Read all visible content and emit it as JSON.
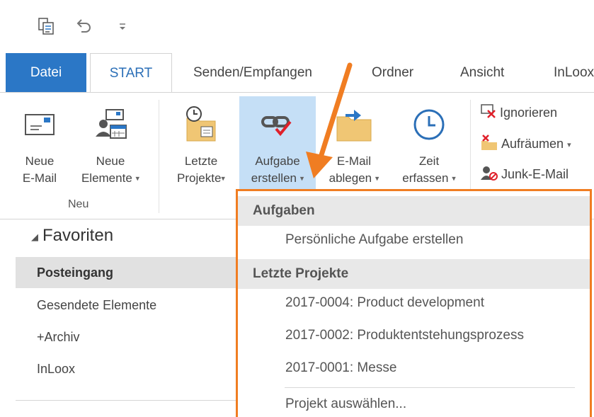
{
  "qat": {
    "icons": [
      "send-receive-icon",
      "undo-icon",
      "customize-icon"
    ],
    "customize_glyph": "⚲"
  },
  "tabs": [
    {
      "label": "Datei"
    },
    {
      "label": "START"
    },
    {
      "label": "Senden/Empfangen"
    },
    {
      "label": "Ordner"
    },
    {
      "label": "Ansicht"
    },
    {
      "label": "InLoox"
    }
  ],
  "ribbon": {
    "new_email": {
      "line1": "Neue",
      "line2": "E-Mail"
    },
    "new_items": {
      "line1": "Neue",
      "line2": "Elemente"
    },
    "group_new": "Neu",
    "recent_projects": {
      "line1": "Letzte",
      "line2": "Projekte"
    },
    "create_task": {
      "line1": "Aufgabe",
      "line2": "erstellen"
    },
    "file_email": {
      "line1": "E-Mail",
      "line2": "ablegen"
    },
    "track_time": {
      "line1": "Zeit",
      "line2": "erfassen"
    },
    "ignore": "Ignorieren",
    "cleanup": "Aufräumen",
    "junk": "Junk-E-Mail",
    "caret": "▾",
    "accent_color": "#f07d22",
    "highlight_color": "#c5dff6"
  },
  "nav": {
    "favorites_label": "Favoriten",
    "favorites_glyph": "◢",
    "items": [
      {
        "label": "Posteingang"
      },
      {
        "label": "Gesendete Elemente"
      },
      {
        "label": "+Archiv"
      },
      {
        "label": "InLoox"
      }
    ]
  },
  "dropdown": {
    "tasks_header": "Aufgaben",
    "personal_task": "Persönliche Aufgabe erstellen",
    "recent_header": "Letzte Projekte",
    "projects": [
      "2017-0004: Product development",
      "2017-0002: Produktentstehungsprozess",
      "2017-0001: Messe"
    ],
    "select_project": "Projekt auswählen..."
  }
}
